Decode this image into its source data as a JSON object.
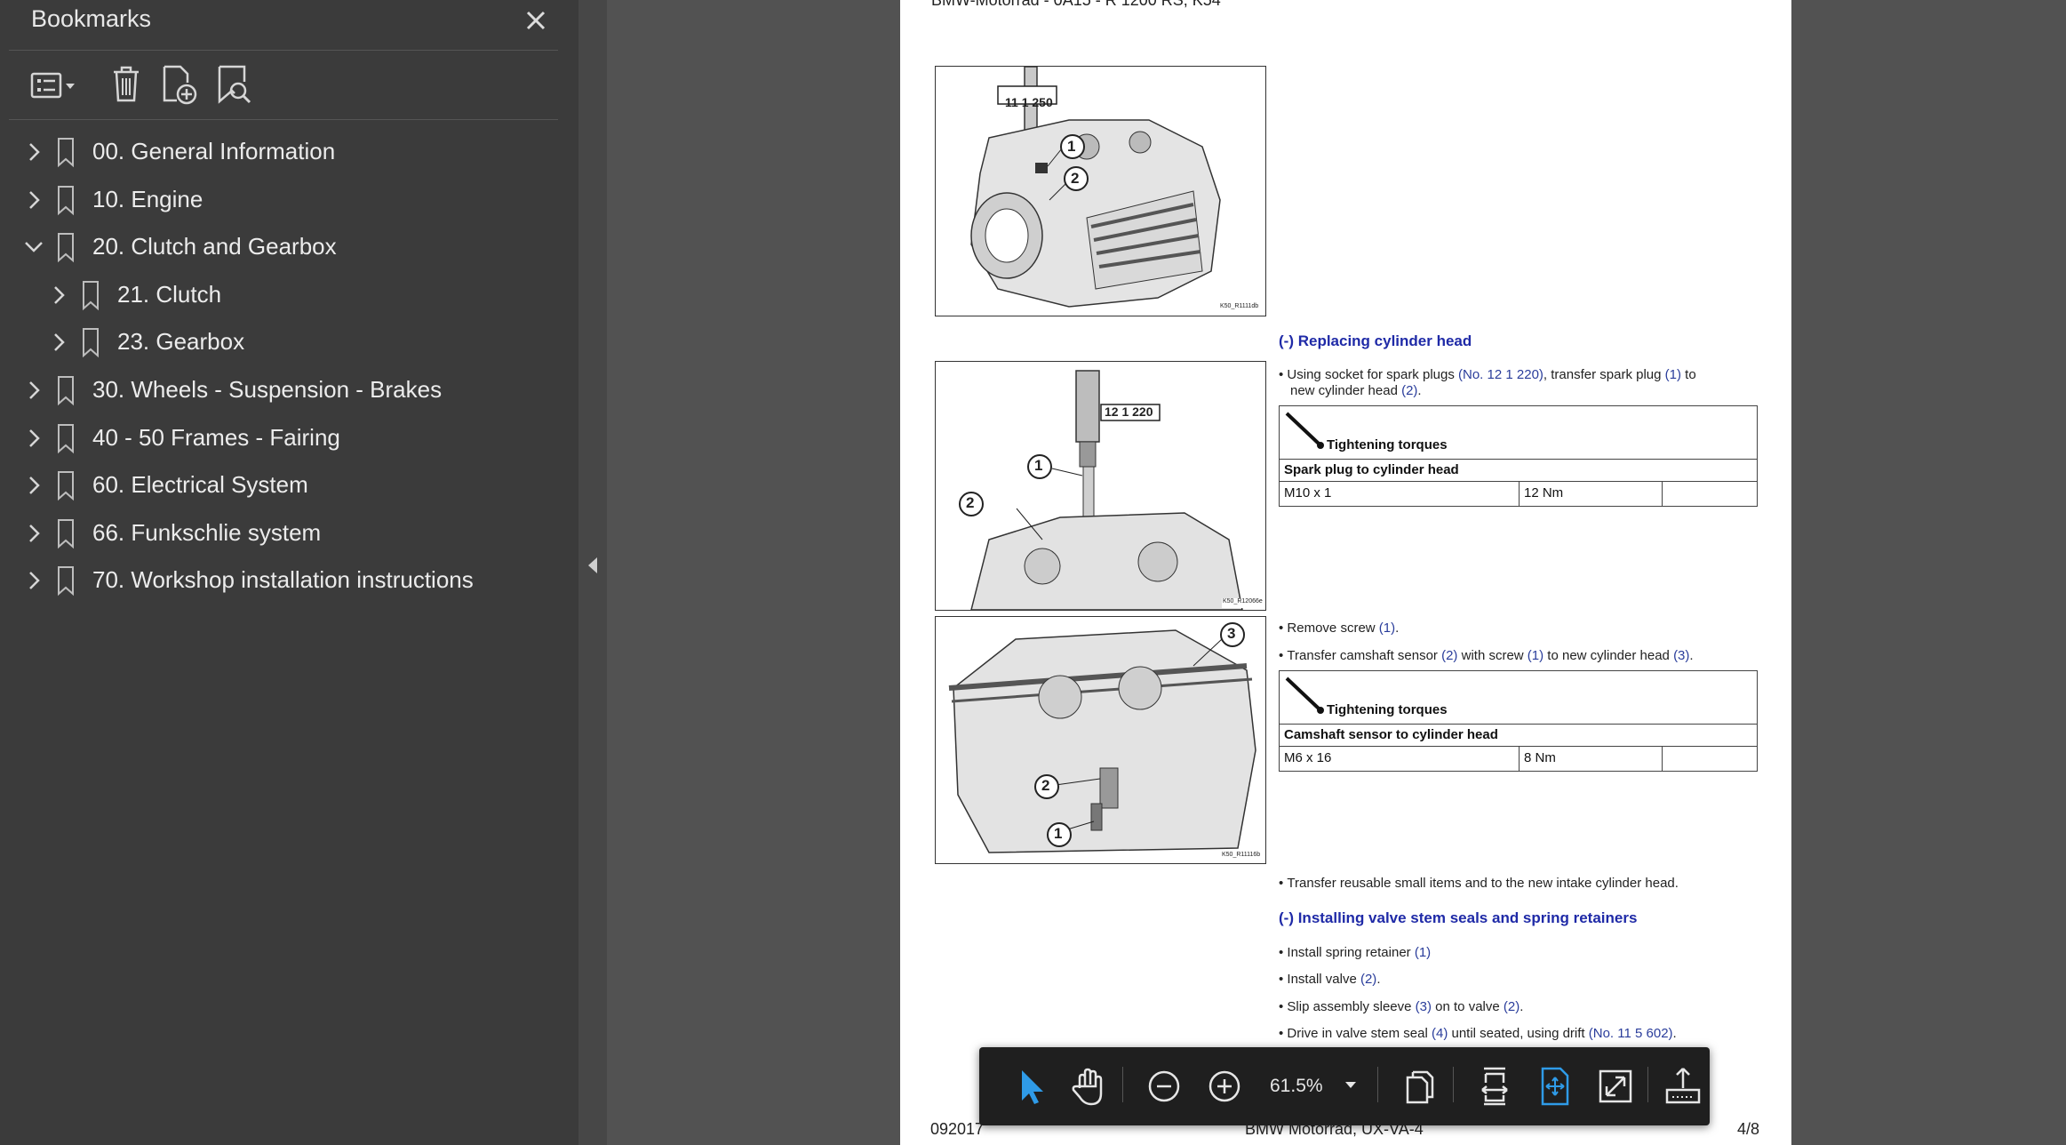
{
  "sidebar": {
    "title": "Bookmarks",
    "items": [
      {
        "label": "00. General Information",
        "expanded": false,
        "level": 0
      },
      {
        "label": "10. Engine",
        "expanded": false,
        "level": 0
      },
      {
        "label": "20. Clutch and Gearbox",
        "expanded": true,
        "level": 0
      },
      {
        "label": "21. Clutch",
        "expanded": false,
        "level": 1
      },
      {
        "label": "23. Gearbox",
        "expanded": false,
        "level": 1
      },
      {
        "label": "30. Wheels - Suspension - Brakes",
        "expanded": false,
        "level": 0
      },
      {
        "label": "40 - 50 Frames - Fairing",
        "expanded": false,
        "level": 0
      },
      {
        "label": "60. Electrical System",
        "expanded": false,
        "level": 0
      },
      {
        "label": "66. Funkschlie system",
        "expanded": false,
        "level": 0
      },
      {
        "label": "70. Workshop installation instructions",
        "expanded": false,
        "level": 0
      }
    ]
  },
  "document": {
    "header": "BMW-Motorrad - 0A15 - R 1200 RS, K54",
    "footer_left": "092017",
    "footer_center": "BMW Motorrad, UX-VA-4",
    "footer_right": "4/8",
    "figures": [
      {
        "tool_label": "11 1 250",
        "callouts": [
          "1",
          "2"
        ],
        "code": "K50_R1111db"
      },
      {
        "tool_label": "12 1 220",
        "callouts": [
          "1",
          "2"
        ],
        "code": "K50_R12066e"
      },
      {
        "tool_label": "",
        "callouts": [
          "3",
          "2",
          "1"
        ],
        "code": "K50_R11116b"
      }
    ],
    "section1": {
      "heading": "(-) Replacing cylinder head",
      "bullet1": {
        "t1": "Using socket for spark plugs ",
        "ref1": "(No. 12 1 220)",
        "t2": ", transfer spark plug ",
        "ref2": "(1)",
        "t3": " to",
        "t4": "new cylinder head ",
        "ref3": "(2)",
        "t5": "."
      },
      "torque": {
        "title": "Tightening torques",
        "subtitle": "Spark plug to cylinder head",
        "spec": "M10 x 1",
        "value": "12 Nm"
      }
    },
    "section2": {
      "bullet1": {
        "t1": "Remove screw ",
        "ref1": "(1)",
        "t2": "."
      },
      "bullet2": {
        "t1": "Transfer camshaft sensor ",
        "ref1": "(2)",
        "t2": " with screw ",
        "ref2": "(1)",
        "t3": " to new cylinder head ",
        "ref3": "(3)",
        "t4": "."
      },
      "torque": {
        "title": "Tightening torques",
        "subtitle": "Camshaft sensor to cylinder head",
        "spec": "M6 x 16",
        "value": "8 Nm"
      }
    },
    "bullet_transfer": "Transfer reusable small items and to the new intake cylinder head.",
    "section3": {
      "heading": "(-) Installing valve stem seals and spring retainers",
      "b1": {
        "t1": "Install spring retainer ",
        "ref1": "(1)"
      },
      "b2": {
        "t1": "Install valve ",
        "ref1": "(2)",
        "t2": "."
      },
      "b3": {
        "t1": "Slip assembly sleeve ",
        "ref1": "(3)",
        "t2": " on to valve ",
        "ref2": "(2)",
        "t3": "."
      },
      "b4": {
        "t1": "Drive in valve stem seal ",
        "ref1": "(4)",
        "t2": " until seated, using drift ",
        "ref2": "(No. 11 5 602)",
        "t3": "."
      }
    }
  },
  "toolbar": {
    "zoom": "61.5%",
    "accent": "#2f9be8"
  }
}
